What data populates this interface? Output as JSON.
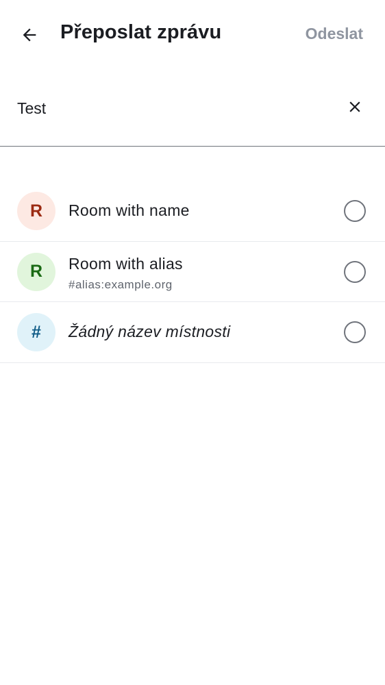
{
  "header": {
    "title": "Přeposlat zprávu",
    "send_label": "Odeslat",
    "back_icon": "arrow-left-icon"
  },
  "search": {
    "value": "Test",
    "clear_icon": "close-icon"
  },
  "rooms": [
    {
      "avatar_letter": "R",
      "avatar_bg": "#fde9e3",
      "avatar_fg": "#9b2a12",
      "name": "Room with name",
      "alias": "",
      "selected": false
    },
    {
      "avatar_letter": "R",
      "avatar_bg": "#e1f5dc",
      "avatar_fg": "#1a6a14",
      "name": "Room with alias",
      "alias": "#alias:example.org",
      "selected": false
    },
    {
      "avatar_letter": "#",
      "avatar_bg": "#e0f2f9",
      "avatar_fg": "#0d5a85",
      "name": "Žádný název místnosti",
      "alias": "",
      "selected": false,
      "italic": true
    }
  ]
}
